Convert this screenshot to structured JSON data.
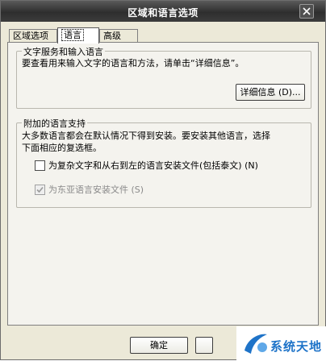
{
  "window": {
    "title": "区域和语言选项"
  },
  "tabs": [
    {
      "label": "区域选项"
    },
    {
      "label": "语言"
    },
    {
      "label": "高级"
    }
  ],
  "text_services": {
    "title": "文字服务和输入语言",
    "description": "要查看用来输入文字的语言和方法，请单击“详细信息”。",
    "details_button": "详细信息 (D)..."
  },
  "supplemental": {
    "title": "附加的语言支持",
    "description_line1": "大多数语言都会在默认情况下得到安装。要安装其他语言，选择",
    "description_line2": "下面相应的复选框。",
    "complex_script": {
      "label": "为复杂文字和从右到左的语言安装文件(包括泰文) (N)",
      "checked": false,
      "enabled": true
    },
    "east_asian": {
      "label": "为东亚语言安装文件 (S)",
      "checked": true,
      "enabled": false
    }
  },
  "footer": {
    "ok_button": "确定"
  },
  "watermark": {
    "text": "系统天地",
    "accent": "#1e73c8"
  },
  "colors": {
    "titlebar": "#3c3c3c",
    "dialog": "#ece9d8",
    "panel": "#f4f3ee"
  }
}
